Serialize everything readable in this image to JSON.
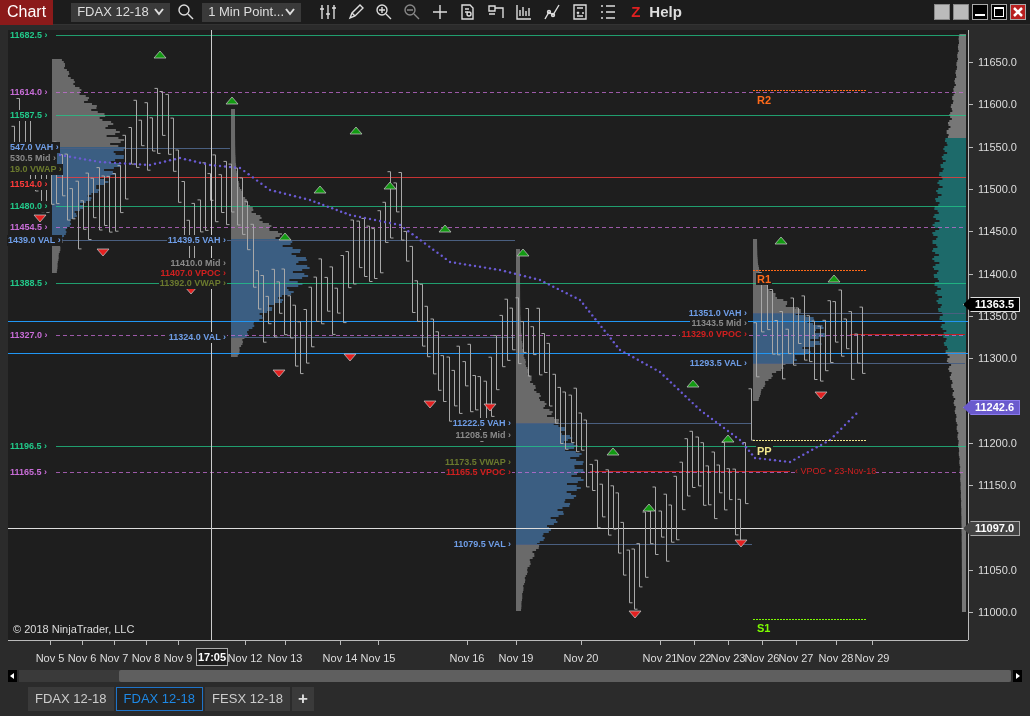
{
  "window": {
    "title": "Chart"
  },
  "toolbar": {
    "instrument": "FDAX 12-18",
    "interval": "1 Min Point...",
    "logo_letter": "Z",
    "help": "Help"
  },
  "levels": [
    {
      "label": "11682.5 ›",
      "color": "#22c98a",
      "kind": "solid"
    },
    {
      "label": "11614.0 ›",
      "color": "#c86dd7",
      "kind": "dashed"
    },
    {
      "label": "11587.5 ›",
      "color": "#22c98a",
      "kind": "solid"
    },
    {
      "label": "11514.0 ›",
      "color": "#ff3b3b",
      "kind": "solid"
    },
    {
      "label": "11480.0 ›",
      "color": "#22c98a",
      "kind": "solid"
    },
    {
      "label": "11454.5 ›",
      "color": "#c86dd7",
      "kind": "dashed"
    },
    {
      "label": "11388.5 ›",
      "color": "#22c98a",
      "kind": "solid"
    },
    {
      "label": "11327.0 ›",
      "color": "#c86dd7",
      "kind": "dashed"
    },
    {
      "label": "11196.5 ›",
      "color": "#22c98a",
      "kind": "solid"
    },
    {
      "label": "11165.5 ›",
      "color": "#c86dd7",
      "kind": "dashed"
    }
  ],
  "sessions": [
    {
      "labels": [
        {
          "text": "547.0 VAH ›",
          "color": "#6f9ee8"
        },
        {
          "text": "530.5 Mid ›",
          "color": "#8a8a8a"
        },
        {
          "text": "19.0 VWAP ›",
          "color": "#6b7a2e"
        },
        {
          "text": "1439.0 VAL ›",
          "color": "#6f9ee8"
        }
      ]
    },
    {
      "labels": [
        {
          "text": "11439.5 VAH ›",
          "color": "#6f9ee8"
        },
        {
          "text": "11410.0 Mid ›",
          "color": "#8a8a8a"
        },
        {
          "text": "11407.0 VPOC ›",
          "color": "#d02020"
        },
        {
          "text": "11392.0 VWAP ›",
          "color": "#6b7a2e"
        },
        {
          "text": "11324.0 VAL ›",
          "color": "#6f9ee8"
        }
      ]
    },
    {
      "labels": [
        {
          "text": "11222.5 VAH ›",
          "color": "#6f9ee8"
        },
        {
          "text": "11208.5 Mid ›",
          "color": "#8a8a8a"
        },
        {
          "text": "11173.5 VWAP ›",
          "color": "#6b7a2e"
        },
        {
          "text": "11165.5 VPOC ›",
          "color": "#d02020"
        },
        {
          "text": "11079.5 VAL ›",
          "color": "#6f9ee8"
        }
      ]
    },
    {
      "labels": [
        {
          "text": "11351.0 VAH ›",
          "color": "#6f9ee8"
        },
        {
          "text": "11343.5 Mid ›",
          "color": "#8a8a8a"
        },
        {
          "text": "11329.0 VPOC ›",
          "color": "#d02020"
        },
        {
          "text": "11293.5 VAL ›",
          "color": "#6f9ee8"
        }
      ]
    }
  ],
  "vpoc_note": "‹ VPOC • 23-Nov-18",
  "pivots": [
    {
      "label": "R2",
      "color": "#ff6a1a"
    },
    {
      "label": "R1",
      "color": "#ff6a1a"
    },
    {
      "label": "PP",
      "color": "#f0e68c"
    },
    {
      "label": "S1",
      "color": "#7cfc00"
    }
  ],
  "copyright": "© 2018 NinjaTrader, LLC",
  "price_axis": {
    "ticks": [
      "11650.0",
      "11600.0",
      "11550.0",
      "11500.0",
      "11450.0",
      "11400.0",
      "11350.0",
      "11300.0",
      "11200.0",
      "11150.0",
      "11050.0",
      "11000.0"
    ],
    "markers": [
      {
        "text": "11363.5",
        "kind": "last"
      },
      {
        "text": "11242.6",
        "kind": "indicator"
      },
      {
        "text": "11097.0",
        "kind": "line"
      }
    ]
  },
  "time_axis": {
    "labels": [
      "Nov 5",
      "Nov 6",
      "Nov 7",
      "Nov 8",
      "Nov 9",
      "Nov 12",
      "Nov 13",
      "Nov 14",
      "Nov 15",
      "Nov 16",
      "Nov 19",
      "Nov 20",
      "Nov 21",
      "Nov 22",
      "Nov 23",
      "Nov 26",
      "Nov 27",
      "Nov 28",
      "Nov 29"
    ],
    "cursor_time": "17:05"
  },
  "tabs": [
    {
      "label": "FDAX 12-18",
      "selected": false
    },
    {
      "label": "FDAX 12-18",
      "selected": true
    },
    {
      "label": "FESX 12-18",
      "selected": false
    }
  ],
  "add_tab": "+"
}
